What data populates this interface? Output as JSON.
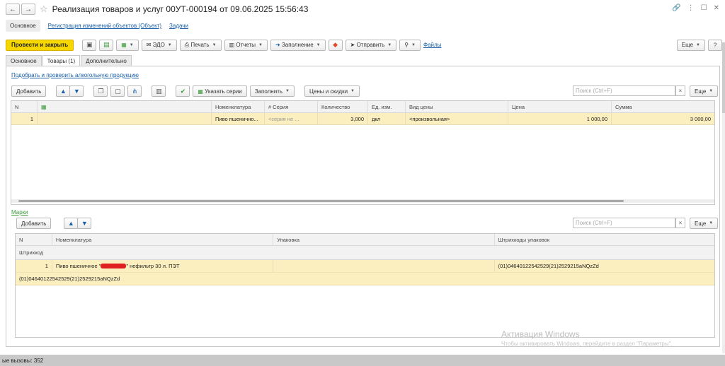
{
  "window": {
    "title": "Реализация товаров и услуг 00УТ-000194 от 09.06.2025 15:56:43"
  },
  "nav_tabs": [
    "Основное",
    "Регистрация изменений объектов (Объект)",
    "Задачи"
  ],
  "toolbar": {
    "post_and_close": "Провести и закрыть",
    "edo": "ЭДО",
    "print": "Печать",
    "reports": "Отчеты",
    "fill": "Заполнение",
    "send": "Отправить",
    "files": "Файлы",
    "more": "Еще"
  },
  "tabs": [
    "Основное",
    "Товары (1)",
    "Дополнительно"
  ],
  "goods": {
    "alcohol_link": "Подобрать и проверить алкогольную продукцию",
    "add": "Добавить",
    "specify_series": "Указать серии",
    "fill": "Заполнить",
    "prices": "Цены и скидки",
    "search_placeholder": "Поиск (Ctrl+F)",
    "clear": "×",
    "more": "Еще",
    "columns": [
      "N",
      "",
      "Номенклатура",
      "Серия",
      "Количество",
      "Ед. изм.",
      "Вид цены",
      "Цена",
      "Сумма"
    ],
    "rows": [
      [
        "1",
        "",
        "Пиво пшенично...",
        "<серия не ...",
        "3,000",
        "дкл",
        "<произвольная>",
        "1 000,00",
        "3 000,00"
      ]
    ]
  },
  "marks": {
    "link": "Марки",
    "add": "Добавить",
    "search_placeholder": "Поиск (Ctrl+F)",
    "clear": "×",
    "more": "Еще",
    "columns": [
      "N",
      "Номенклатура",
      "Упаковка",
      "Штрихкоды упаковок"
    ],
    "sub_header": "Штрихкод",
    "row": {
      "n": "1",
      "product": "Пиво пшеничное \"",
      "product_suffix": "\" нефильтр 30 л. ПЭТ",
      "packaging": "",
      "barcode": "(01)04640122542529(21)2529215aNQzZd",
      "sub_barcode": "(01)04640122542529(21)2529215aNQzZd"
    }
  },
  "watermark": {
    "line1": "Активация Windows",
    "line2": "Чтобы активировать Windows, перейдите в раздел \"Параметры\"."
  },
  "status": {
    "text": "ые вызовы: 352"
  },
  "colors": {
    "primary_button": "#f6d800",
    "selected_row": "#fbeebf",
    "link": "#1a5fa8"
  }
}
